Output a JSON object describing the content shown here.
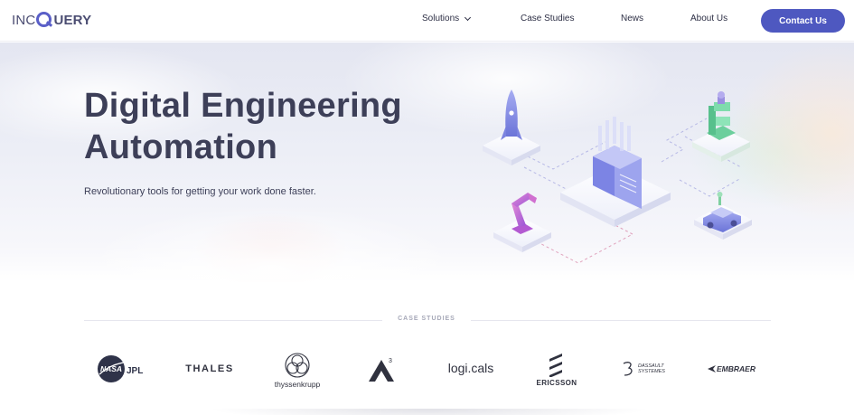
{
  "nav": {
    "logo": {
      "light": "INC",
      "bold": "UERY"
    },
    "items": [
      "Solutions",
      "Case Studies",
      "News",
      "About Us"
    ],
    "contact": "Contact Us"
  },
  "hero": {
    "title_line1": "Digital Engineering",
    "title_line2": "Automation",
    "subtitle": "Revolutionary tools for getting your work done faster."
  },
  "case_studies": {
    "label": "CASE STUDIES",
    "logos": [
      {
        "name": "NASA JPL",
        "nasa": "NASA",
        "jpl": "JPL"
      },
      {
        "name": "THALES"
      },
      {
        "name": "thyssenkrupp"
      },
      {
        "name": "A3",
        "sup": "3"
      },
      {
        "name": "logi.cals",
        "text": "logi.cals"
      },
      {
        "name": "ERICSSON"
      },
      {
        "name": "Dassault Systemes",
        "line1": "DASSAULT",
        "line2": "SYSTEMES"
      },
      {
        "name": "EMBRAER"
      }
    ]
  },
  "colors": {
    "brand": "#4e58c0",
    "text": "#3d3f58"
  }
}
